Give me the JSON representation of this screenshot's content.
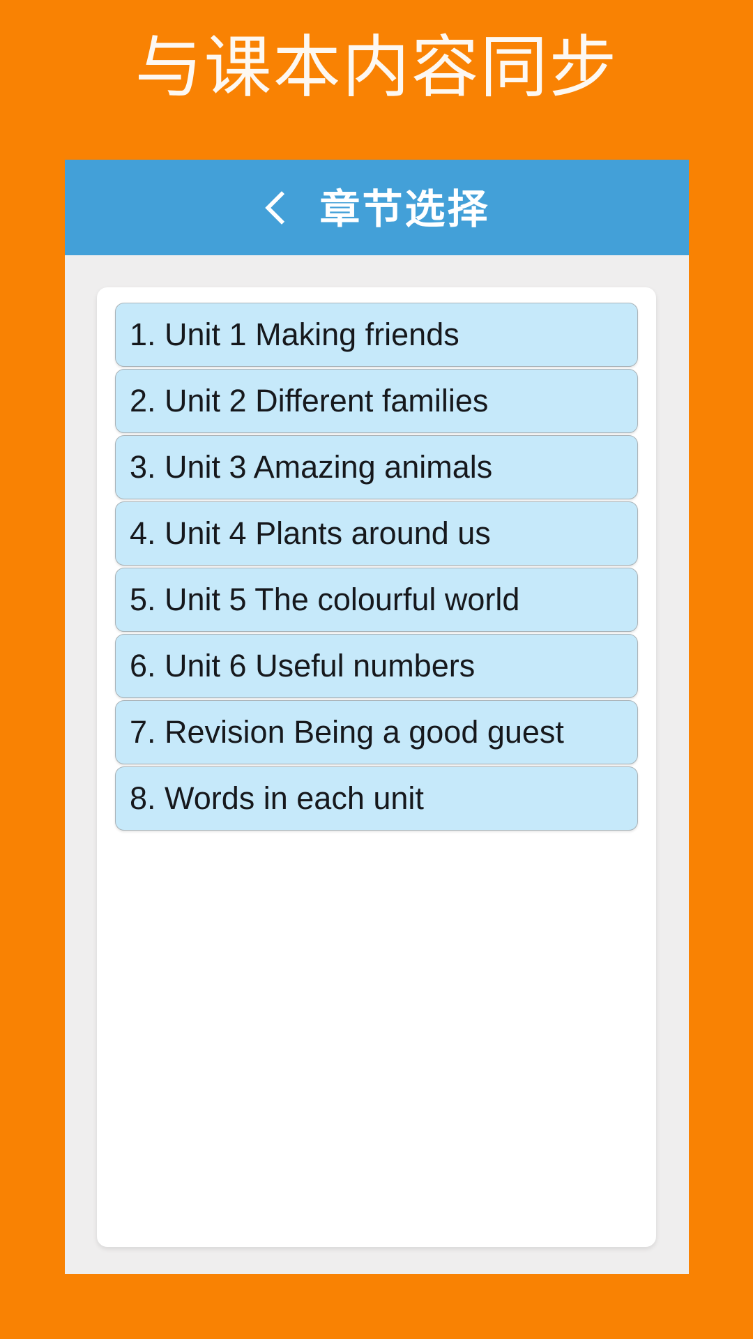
{
  "banner": {
    "title": "与课本内容同步",
    "background_color": "#f98203",
    "text_color": "#fdf8f2"
  },
  "app": {
    "panel_background": "#efeeee",
    "title_bar": {
      "background_color": "#43a0d8",
      "back_icon": "chevron-left-icon",
      "title": "章节选择",
      "title_color": "#ffffff"
    },
    "card": {
      "background_color": "#ffffff"
    },
    "chapter_list": {
      "item_background": "#c6e9fa",
      "item_border": "#a9b3b8",
      "item_text_color": "#16181c",
      "items": [
        {
          "index": "1.",
          "label": "1. Unit 1 Making friends"
        },
        {
          "index": "2.",
          "label": "2. Unit 2 Different families"
        },
        {
          "index": "3.",
          "label": "3. Unit 3 Amazing animals"
        },
        {
          "index": "4.",
          "label": "4. Unit 4 Plants around us"
        },
        {
          "index": "5.",
          "label": "5. Unit 5 The colourful world"
        },
        {
          "index": "6.",
          "label": "6. Unit 6 Useful numbers"
        },
        {
          "index": "7.",
          "label": "7. Revision Being a good guest"
        },
        {
          "index": "8.",
          "label": "8. Words in each unit"
        }
      ]
    }
  }
}
